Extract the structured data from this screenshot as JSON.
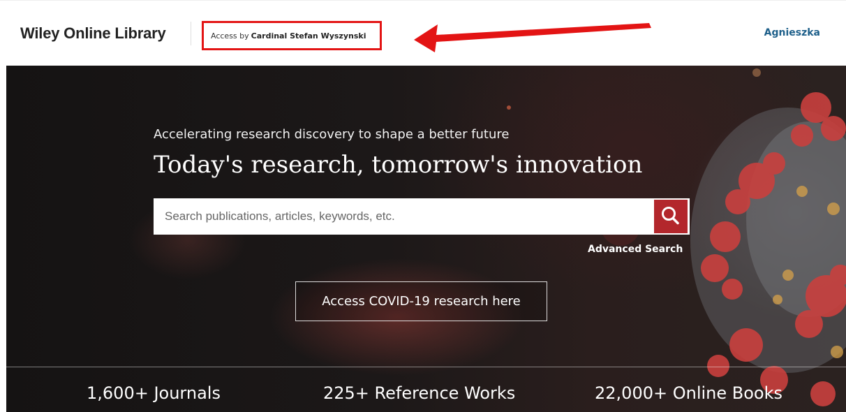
{
  "header": {
    "logo_text": "Wiley Online Library",
    "access_prefix": "Access by",
    "access_institution": "Cardinal Stefan Wyszynski",
    "user_name": "Agnieszka",
    "annotation_color": "#e31414"
  },
  "hero": {
    "tagline": "Accelerating research discovery to shape a better future",
    "headline": "Today's research, tomorrow's innovation",
    "search": {
      "placeholder": "Search publications, articles, keywords, etc.",
      "value": "",
      "button_icon": "search-icon"
    },
    "advanced_search_label": "Advanced Search",
    "covid_button_label": "Access COVID-19 research here",
    "stats": {
      "journals": "1,600+ Journals",
      "reference_works": "225+ Reference Works",
      "online_books": "22,000+ Online Books"
    }
  },
  "colors": {
    "brand_link": "#1d5f8a",
    "search_button": "#b3272c",
    "hero_background": "#1c1818"
  }
}
